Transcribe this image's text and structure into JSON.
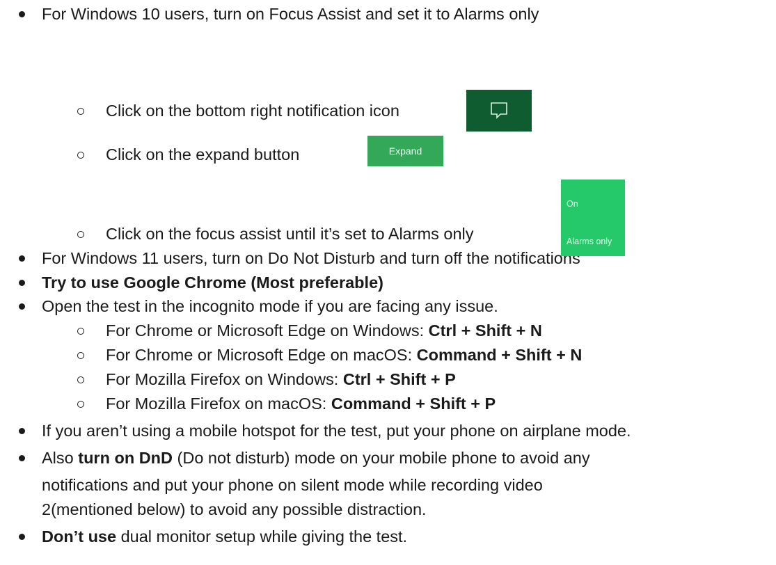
{
  "items": [
    {
      "level": 1,
      "parts": [
        {
          "text": "For Windows 10 users, turn on Focus Assist and set it to Alarms only",
          "bold": false
        }
      ]
    },
    {
      "level": 2,
      "parts": [
        {
          "text": "Click on the bottom right notification icon",
          "bold": false
        }
      ]
    },
    {
      "level": 2,
      "parts": [
        {
          "text": "Click on the expand button",
          "bold": false
        }
      ]
    },
    {
      "level": 2,
      "parts": [
        {
          "text": "Click on the focus assist until it’s set to Alarms only",
          "bold": false
        }
      ]
    },
    {
      "level": 1,
      "parts": [
        {
          "text": "For Windows 11 users, turn on Do Not Disturb and turn off the notifications",
          "bold": false
        }
      ]
    },
    {
      "level": 1,
      "parts": [
        {
          "text": "Try to use Google Chrome (Most preferable)",
          "bold": true
        }
      ]
    },
    {
      "level": 1,
      "parts": [
        {
          "text": "Open the test in the incognito mode if you are facing any issue.",
          "bold": false
        }
      ]
    },
    {
      "level": 2,
      "parts": [
        {
          "text": "For Chrome or Microsoft Edge on Windows: ",
          "bold": false
        },
        {
          "text": "Ctrl + Shift + N",
          "bold": true
        }
      ]
    },
    {
      "level": 2,
      "parts": [
        {
          "text": "For Chrome or Microsoft Edge on macOS: ",
          "bold": false
        },
        {
          "text": "Command + Shift + N",
          "bold": true
        }
      ]
    },
    {
      "level": 2,
      "parts": [
        {
          "text": "For Mozilla Firefox on Windows: ",
          "bold": false
        },
        {
          "text": "Ctrl + Shift + P",
          "bold": true
        }
      ]
    },
    {
      "level": 2,
      "parts": [
        {
          "text": "For Mozilla Firefox on macOS: ",
          "bold": false
        },
        {
          "text": "Command + Shift + P",
          "bold": true
        }
      ]
    },
    {
      "level": 1,
      "parts": [
        {
          "text": "If you aren’t using a mobile hotspot for the test, put your phone on airplane mode.",
          "bold": false
        }
      ]
    },
    {
      "level": 1,
      "parts": [
        {
          "text": "Also ",
          "bold": false
        },
        {
          "text": "turn on DnD",
          "bold": true
        },
        {
          "text": " (Do not disturb) mode on your mobile phone to avoid any",
          "bold": false
        }
      ]
    },
    {
      "level": 0,
      "parts": [
        {
          "text": "notifications and put your phone on silent mode while recording video",
          "bold": false
        }
      ]
    },
    {
      "level": 0,
      "parts": [
        {
          "text": "2(mentioned below) to avoid any possible distraction.",
          "bold": false
        }
      ]
    },
    {
      "level": 1,
      "parts": [
        {
          "text": "Don’t use",
          "bold": true
        },
        {
          "text": " dual monitor setup while giving the test.",
          "bold": false
        }
      ]
    }
  ],
  "expand_button": {
    "label": "Expand"
  },
  "focus_tile": {
    "state": "On",
    "mode": "Alarms only"
  },
  "colors": {
    "notif_icon_bg": "#0e5c30",
    "expand_bg": "#33a858",
    "focus_tile_bg": "#26c96a"
  }
}
